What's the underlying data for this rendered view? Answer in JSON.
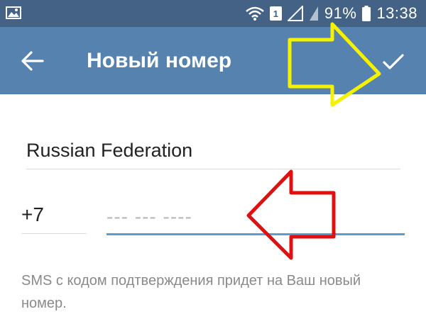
{
  "status_bar": {
    "sim_badge": "1",
    "battery": "91%",
    "time": "13:38",
    "icons": [
      "image-icon",
      "wifi-icon",
      "sim-icon",
      "signal-icon",
      "battery-icon"
    ]
  },
  "app_bar": {
    "title": "Новый номер",
    "back_icon": "back-arrow-icon",
    "done_icon": "checkmark-icon",
    "background": "#5682b0"
  },
  "form": {
    "country": "Russian Federation",
    "country_code": "+7",
    "phone_placeholder": "--- --- ----",
    "phone_value": ""
  },
  "hint": "SMS с кодом подтверждения придет на Ваш новый номер.",
  "annotations": {
    "yellow_arrow_color": "#f5f200",
    "red_arrow_color": "#e01010"
  }
}
